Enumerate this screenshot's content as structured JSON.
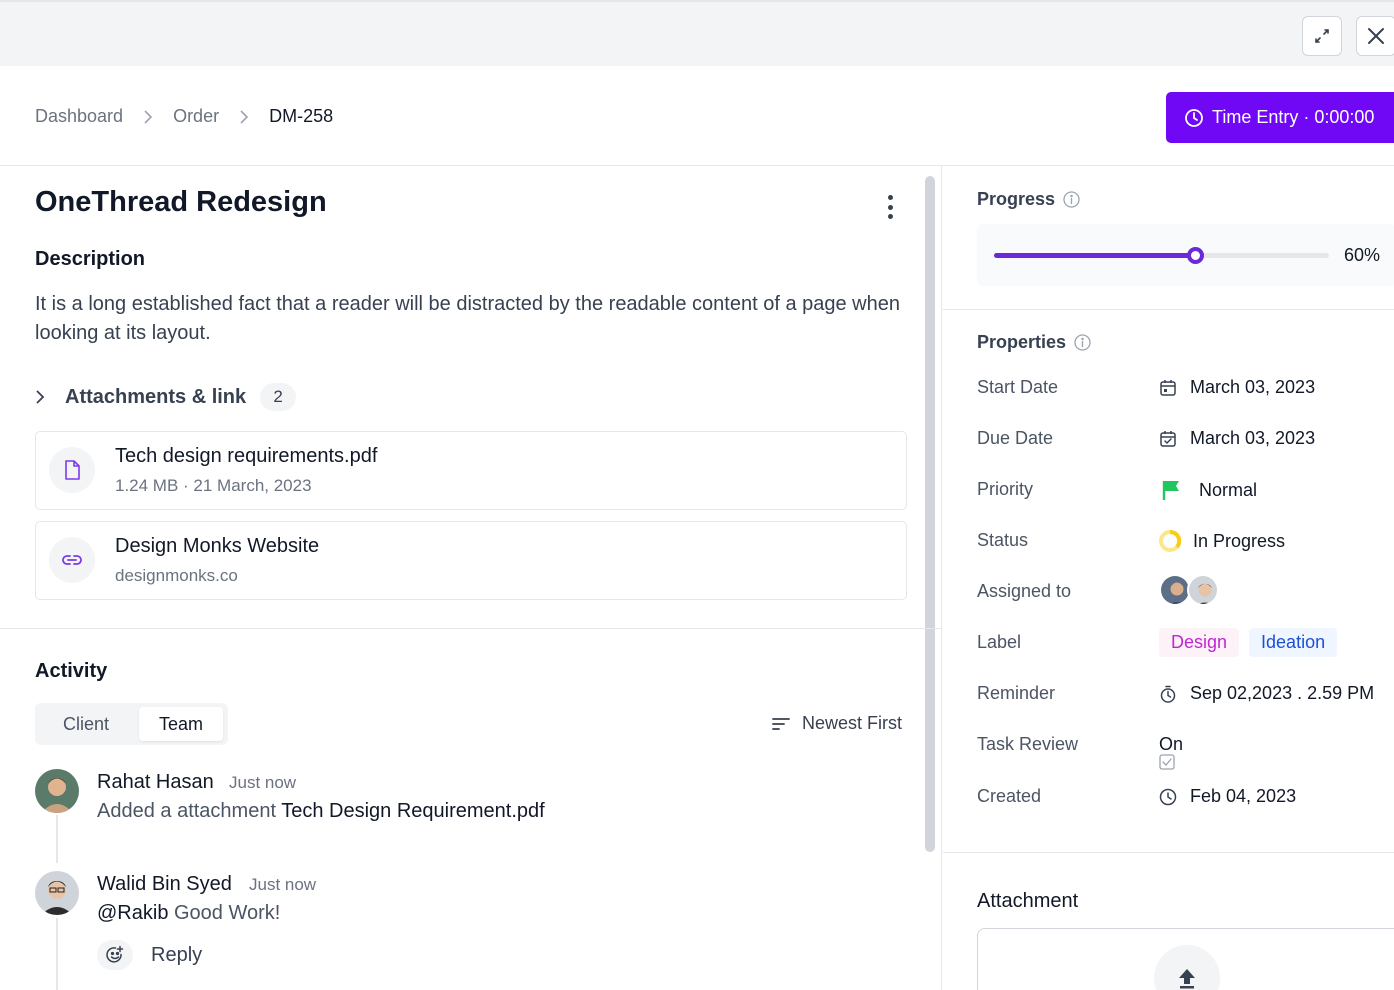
{
  "breadcrumb": {
    "items": [
      "Dashboard",
      "Order"
    ],
    "current": "DM-258"
  },
  "time_entry": {
    "label": "Time Entry · 0:00:00"
  },
  "task": {
    "title": "OneThread Redesign",
    "description_heading": "Description",
    "description": "It is a long established fact that a reader will be distracted by the readable content of a page when looking at its layout."
  },
  "attachments": {
    "label": "Attachments & link",
    "count": "2",
    "items": [
      {
        "name": "Tech design requirements.pdf",
        "meta": "1.24 MB · 21 March, 2023",
        "icon": "file-icon"
      },
      {
        "name": "Design Monks Website",
        "meta": "designmonks.co",
        "icon": "link-icon"
      }
    ]
  },
  "activity": {
    "heading": "Activity",
    "tabs": [
      "Client",
      "Team"
    ],
    "active_tab": "Team",
    "sort_label": "Newest First",
    "entries": [
      {
        "name": "Rahat Hasan",
        "time": "Just now",
        "text": "Added a attachment",
        "highlight": "Tech Design Requirement.pdf"
      },
      {
        "name": "Walid Bin Syed",
        "time": "Just now",
        "mention": "@Rakib",
        "text": "Good Work!"
      }
    ],
    "reply_label": "Reply"
  },
  "progress": {
    "label": "Progress",
    "value": 60,
    "value_label": "60%",
    "color": "#6d28d9"
  },
  "properties": {
    "label": "Properties",
    "start_date": {
      "label": "Start Date",
      "value": "March 03, 2023"
    },
    "due_date": {
      "label": "Due Date",
      "value": "March 03, 2023"
    },
    "priority": {
      "label": "Priority",
      "value": "Normal",
      "color": "#22c55e"
    },
    "status": {
      "label": "Status",
      "value": "In Progress",
      "color": "#facc15"
    },
    "assigned": {
      "label": "Assigned to"
    },
    "label_row": {
      "label": "Label",
      "tags": [
        "Design",
        "Ideation"
      ]
    },
    "reminder": {
      "label": "Reminder",
      "value": "Sep 02,2023 . 2.59 PM"
    },
    "task_review": {
      "label": "Task Review",
      "value": "On"
    },
    "created": {
      "label": "Created",
      "value": "Feb 04, 2023"
    }
  },
  "attachment_panel": {
    "title": "Attachment"
  },
  "accent_color": "#7008f5"
}
